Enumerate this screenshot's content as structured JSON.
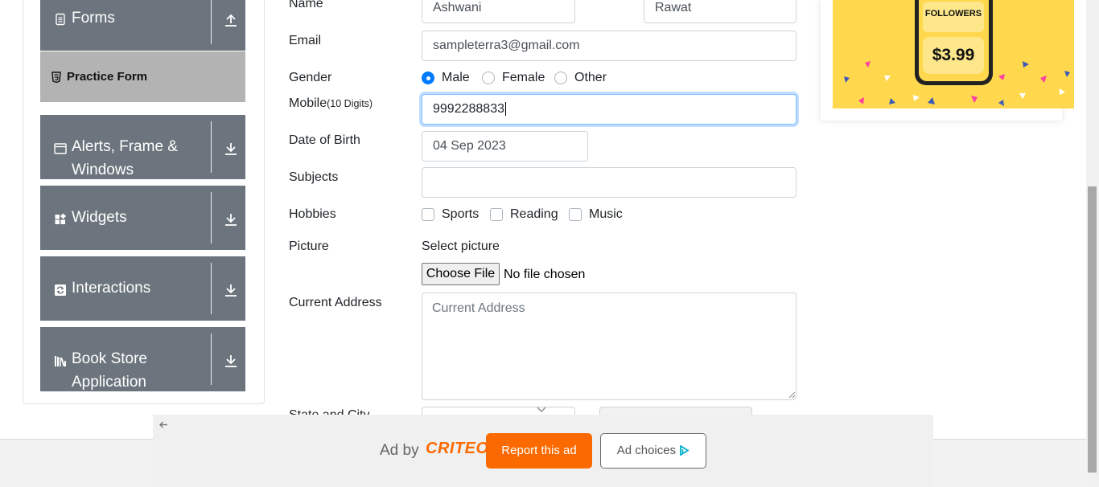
{
  "sidebar": {
    "forms": {
      "title": "Forms",
      "icon": "document-icon",
      "arrow": "collapse-up-icon"
    },
    "practice_form": {
      "label": "Practice Form",
      "icon": "html5-icon"
    },
    "groups": [
      {
        "title_line1": "Alerts, Frame &",
        "title_line2": "Windows",
        "icon": "window-icon"
      },
      {
        "title_line1": "Widgets",
        "title_line2": "",
        "icon": "widgets-icon"
      },
      {
        "title_line1": "Interactions",
        "title_line2": "",
        "icon": "interactions-icon"
      },
      {
        "title_line1": "Book Store",
        "title_line2": "Application",
        "icon": "books-icon"
      }
    ]
  },
  "form": {
    "name_label": "Name",
    "first_name": "Ashwani",
    "last_name": "Rawat",
    "email_label": "Email",
    "email": "sampleterra3@gmail.com",
    "gender_label": "Gender",
    "gender_options": [
      "Male",
      "Female",
      "Other"
    ],
    "gender_selected": "Male",
    "mobile_label": "Mobile",
    "mobile_hint": "(10 Digits)",
    "mobile": "9992288833",
    "dob_label": "Date of Birth",
    "dob": "04 Sep 2023",
    "subjects_label": "Subjects",
    "hobbies_label": "Hobbies",
    "hobbies": [
      "Sports",
      "Reading",
      "Music"
    ],
    "picture_label": "Picture",
    "picture_hint": "Select picture",
    "choose_file": "Choose File",
    "no_file": "No file chosen",
    "address_label": "Current Address",
    "address_placeholder": "Current Address",
    "state_city_label": "State and City"
  },
  "ad_side": {
    "followers": "FOLLOWERS",
    "price": "$3.99"
  },
  "banner": {
    "ad_by": "Ad by",
    "brand": "CRITEO",
    "report": "Report this ad",
    "choices": "Ad choices"
  },
  "colors": {
    "sidebar_bg": "#6c757d",
    "practice_bg": "#b3b3b3",
    "primary": "#007bff",
    "criteo_orange": "#fb6a00",
    "ad_yellow": "#ffd84d"
  }
}
